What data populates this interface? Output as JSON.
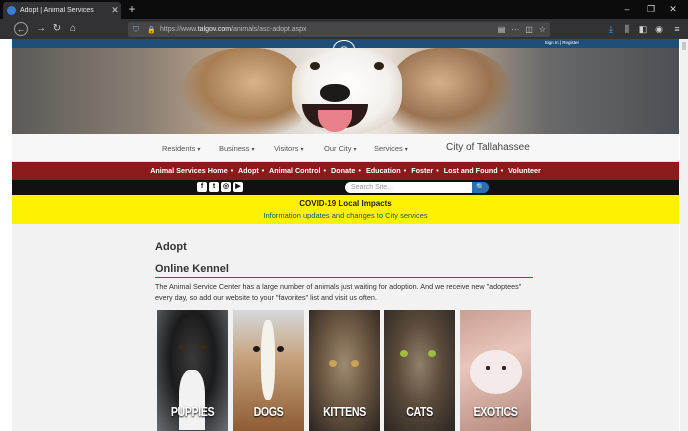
{
  "browser": {
    "tab_title": "Adopt | Animal Services",
    "tab_close": "✕",
    "new_tab": "+",
    "url_prefix": "https://www.",
    "url_host": "talgov.com",
    "url_path": "/animals/asc-adopt.aspx",
    "url_more": "···",
    "window_minimize": "–",
    "window_restore": "❐",
    "window_close": "✕"
  },
  "site": {
    "signin": "Sign In | Register",
    "seal_glyph": "⚖",
    "menu": [
      {
        "label": "Residents",
        "caret": "▾"
      },
      {
        "label": "Business",
        "caret": "▾"
      },
      {
        "label": "Visitors",
        "caret": "▾"
      },
      {
        "label": "Our City",
        "caret": "▾"
      },
      {
        "label": "Services",
        "caret": "▾"
      }
    ],
    "city_title": "City of Tallahassee",
    "animal_nav": [
      "Animal Services Home",
      "Adopt",
      "Animal Control",
      "Donate",
      "Education",
      "Foster",
      "Lost and Found",
      "Volunteer"
    ],
    "nav_separator": "•",
    "social": [
      "f",
      "t",
      "◎",
      "▶"
    ],
    "search_placeholder": "Search Site...",
    "search_button": "🔍",
    "covid_title": "COVID-19 Local Impacts",
    "covid_link": "Information updates and changes to City services"
  },
  "content": {
    "page_title": "Adopt",
    "section_title": "Online Kennel",
    "intro": "The Animal Service Center has a large number of animals just waiting for adoption. And we receive new \"adoptees\" every day, so add our website to your \"favorites\" list and visit us often.",
    "cards": [
      {
        "label": "PUPPIES"
      },
      {
        "label": "DOGS"
      },
      {
        "label": "KITTENS"
      },
      {
        "label": "CATS"
      },
      {
        "label": "EXOTICS"
      }
    ]
  },
  "colors": {
    "red_nav": "#8b1a1a",
    "covid_bg": "#fff200",
    "site_blue": "#1f4e79",
    "rule_red": "#b52b2b"
  }
}
